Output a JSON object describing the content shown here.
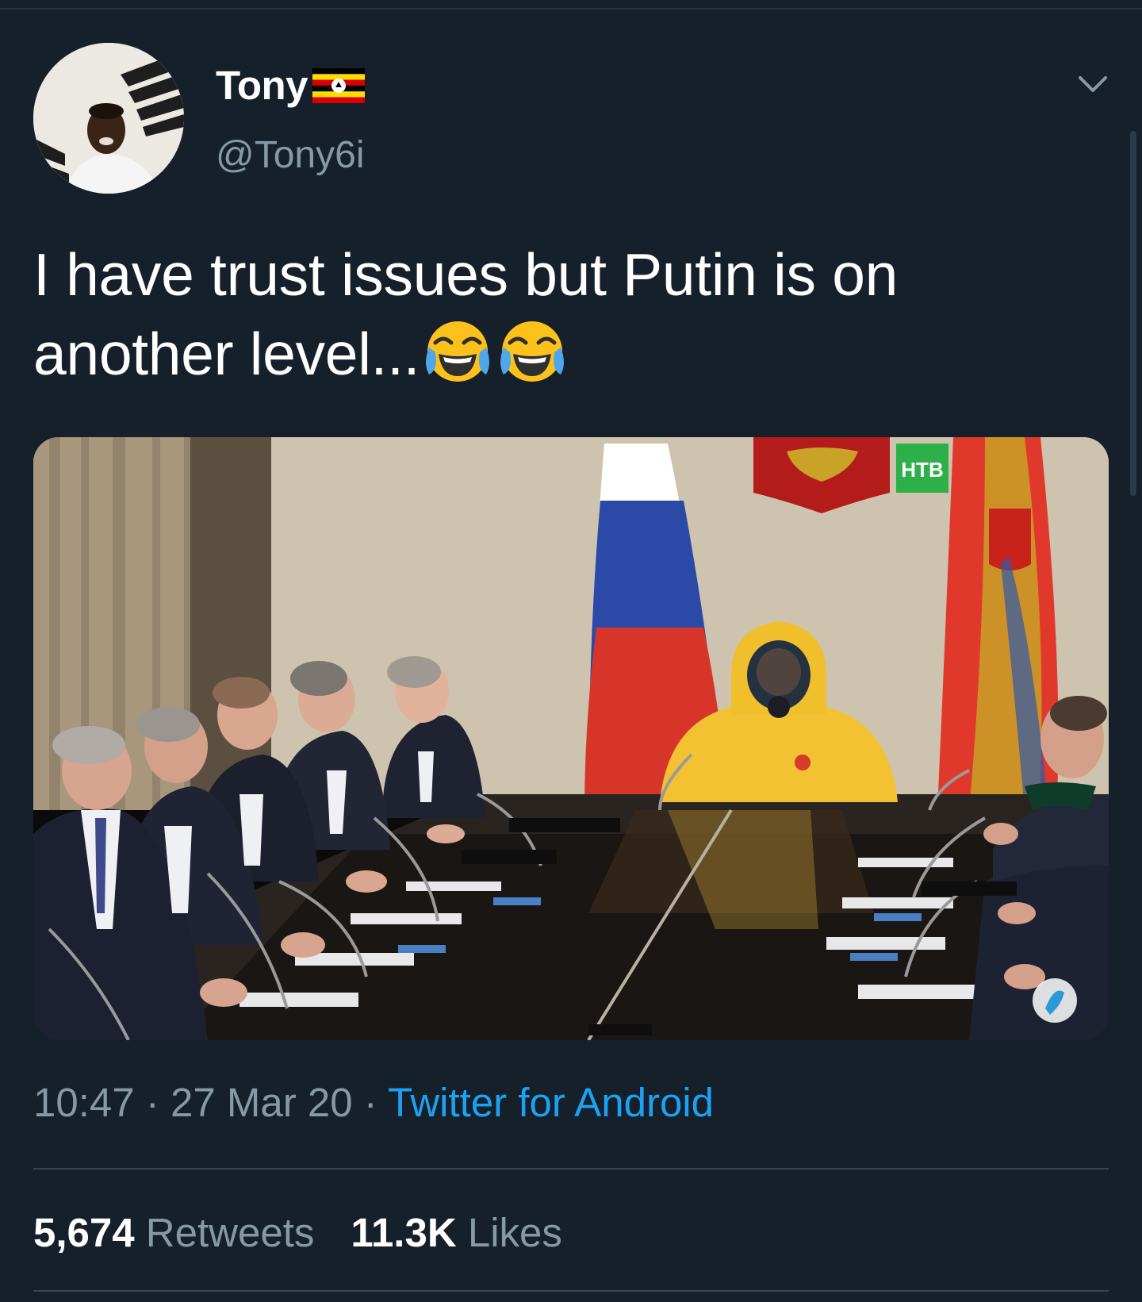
{
  "user": {
    "name": "Tony",
    "handle": "@Tony6i"
  },
  "tweet": {
    "text": "I have trust issues but Putin is on another level..."
  },
  "meta": {
    "time": "10:47",
    "date": "27 Mar 20",
    "separator": " · ",
    "source": "Twitter for Android"
  },
  "stats": {
    "retweets_count": "5,674",
    "retweets_label": "Retweets",
    "likes_count": "11.3K",
    "likes_label": "Likes"
  },
  "media": {
    "logo": "НТВ"
  },
  "icons": {
    "more": "chevron-down-icon",
    "emoji": "face-with-tears-of-joy-icon",
    "flag": "uganda-flag-icon"
  },
  "colors": {
    "background": "#15202b",
    "secondary_text": "#8899a6",
    "link": "#1da1f2",
    "divider": "#38444d"
  }
}
